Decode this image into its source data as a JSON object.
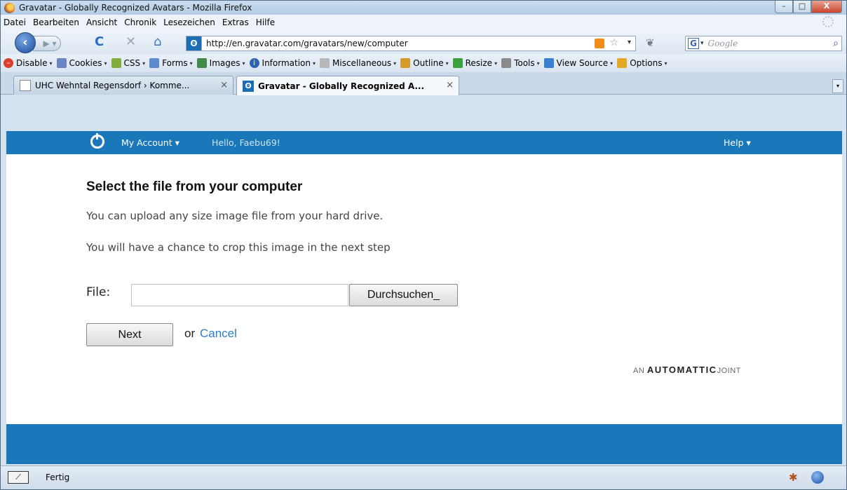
{
  "window": {
    "title": "Gravatar - Globally Recognized Avatars - Mozilla Firefox",
    "controls": {
      "minimize": "–",
      "maximize": "□",
      "close": "X"
    }
  },
  "menubar": {
    "items": [
      "Datei",
      "Bearbeiten",
      "Ansicht",
      "Chronik",
      "Lesezeichen",
      "Extras",
      "Hilfe"
    ]
  },
  "navbar": {
    "url": "http://en.gravatar.com/gravatars/new/computer",
    "search_placeholder": "Google"
  },
  "devbar": {
    "items": [
      {
        "label": "Disable",
        "icon": "disable-icon",
        "color": "#d9402b"
      },
      {
        "label": "Cookies",
        "icon": "cookies-icon",
        "color": "#6b84c4"
      },
      {
        "label": "CSS",
        "icon": "css-icon",
        "color": "#7fae3a"
      },
      {
        "label": "Forms",
        "icon": "forms-icon",
        "color": "#5a8ccf"
      },
      {
        "label": "Images",
        "icon": "images-icon",
        "color": "#3f8a4a"
      },
      {
        "label": "Information",
        "icon": "information-icon",
        "color": "#2e62b5"
      },
      {
        "label": "Miscellaneous",
        "icon": "miscellaneous-icon",
        "color": "#b8b8b8"
      },
      {
        "label": "Outline",
        "icon": "outline-icon",
        "color": "#d69a2a"
      },
      {
        "label": "Resize",
        "icon": "resize-icon",
        "color": "#3ca13c"
      },
      {
        "label": "Tools",
        "icon": "tools-icon",
        "color": "#8a8a8a"
      },
      {
        "label": "View Source",
        "icon": "view-source-icon",
        "color": "#3a7fd0"
      },
      {
        "label": "Options",
        "icon": "options-icon",
        "color": "#e2a925"
      }
    ]
  },
  "tabs": [
    {
      "label": "UHC Wehntal Regensdorf › Komme...",
      "active": false
    },
    {
      "label": "Gravatar - Globally Recognized A...",
      "active": true
    }
  ],
  "site_header": {
    "my_account": "My Account ▾",
    "hello": "Hello, Faebu69!",
    "help": "Help ▾"
  },
  "main": {
    "heading": "Select the file from your computer",
    "para1": "You can upload any size image file from your hard drive.",
    "para2": "You will have a chance to crop this image in the next step",
    "file_label": "File:",
    "file_value": "",
    "browse_label": "Durchsuchen_",
    "next_label": "Next",
    "or_text": "or",
    "cancel_label": "Cancel",
    "footer_an": "AN",
    "footer_brand": "AUTOMATTIC",
    "footer_joint": "JOINT"
  },
  "statusbar": {
    "text": "Fertig"
  },
  "colors": {
    "brand_blue": "#1a77ba",
    "link_blue": "#2a7ec4"
  }
}
